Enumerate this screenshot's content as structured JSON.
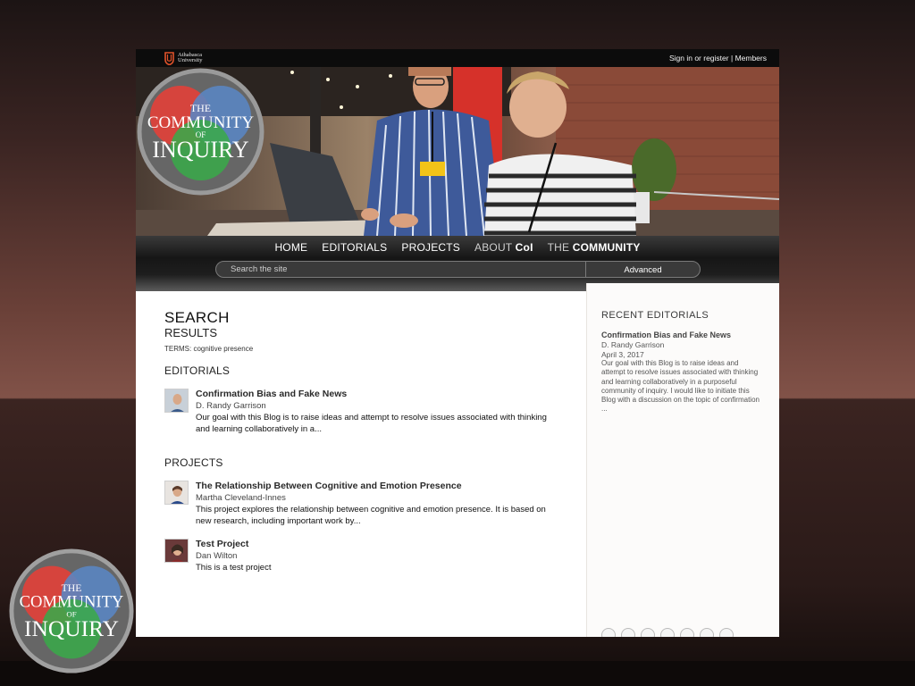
{
  "topbar": {
    "brand_line1": "Athabasca",
    "brand_line2": "University",
    "signin_label": "Sign in or register",
    "separator": "|",
    "members_label": "Members"
  },
  "logo": {
    "line_the": "THE",
    "line_community": "COMMUNITY",
    "line_of": "OF",
    "line_inquiry": "INQUIRY"
  },
  "nav": {
    "items": [
      {
        "label": "HOME"
      },
      {
        "label": "EDITORIALS"
      },
      {
        "label": "PROJECTS"
      },
      {
        "label_prefix": "ABOUT",
        "label_bold": "CoI"
      },
      {
        "label_prefix": "THE",
        "label_bold": "COMMUNITY"
      }
    ],
    "search_placeholder": "Search the site",
    "advanced_label": "Advanced"
  },
  "main": {
    "heading": "SEARCH",
    "subheading": "RESULTS",
    "terms": "TERMS: cognitive presence",
    "editorials_heading": "EDITORIALS",
    "editorials": [
      {
        "title": "Confirmation Bias and Fake News",
        "author": "D. Randy Garrison",
        "excerpt": "Our goal with this Blog is to raise ideas and attempt to resolve issues associated with thinking and learning collaboratively in a..."
      }
    ],
    "projects_heading": "PROJECTS",
    "projects": [
      {
        "title": "The Relationship Between Cognitive and Emotion Presence",
        "author": "Martha Cleveland-Innes",
        "excerpt": "This project explores the relationship between cognitive and emotion presence. It is based on new research, including important work by..."
      },
      {
        "title": "Test Project",
        "author": "Dan Wilton",
        "excerpt": "This is a test project"
      }
    ]
  },
  "sidebar": {
    "heading": "RECENT EDITORIALS",
    "title": "Confirmation Bias and Fake News",
    "author": "D. Randy Garrison",
    "date": "April 3, 2017",
    "excerpt": "Our goal with this Blog is to raise ideas and attempt to resolve issues associated with thinking and learning collaboratively in a purposeful community of inquiry. I would like to initiate this Blog with a discussion on the topic of confirmation ..."
  },
  "colors": {
    "logo_red": "#e0413a",
    "logo_blue": "#5a86c4",
    "logo_green": "#3aa84a",
    "au_orange": "#e0522a"
  }
}
